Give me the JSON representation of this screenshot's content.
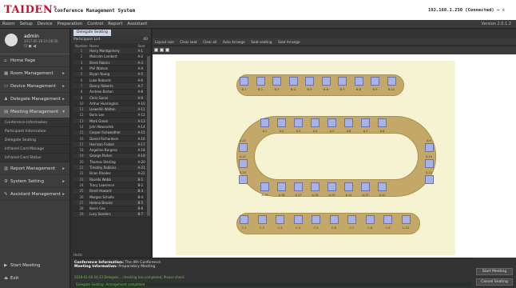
{
  "titlebar": {
    "logo": "TAIDEN",
    "logo_mark": "®",
    "title": "Conference Management System",
    "connection": "192.168.1.230 (Connected)",
    "window_controls": "– ✕"
  },
  "menu": {
    "items": [
      "Room",
      "Setup",
      "Device",
      "Preparation",
      "Control",
      "Report",
      "Assistant"
    ],
    "version": "Version 2.0.1.2"
  },
  "user": {
    "name": "admin",
    "date": "2017-05-18 10:28:26",
    "icons": "⏻ ◼ ◀"
  },
  "nav": {
    "items": [
      {
        "label": "Home Page",
        "icon": "home-icon"
      },
      {
        "label": "Room Management",
        "icon": "room-icon"
      },
      {
        "label": "Device Management",
        "icon": "device-icon"
      },
      {
        "label": "Delegate Management",
        "icon": "delegate-icon"
      },
      {
        "label": "Meeting Management",
        "icon": "meeting-icon"
      }
    ],
    "subitems": [
      "Conference Information",
      "Participant Information",
      "Delegate Seating",
      "Infrared Card Manage",
      "Infrared Card Status"
    ],
    "items2": [
      {
        "label": "Report Management",
        "icon": "report-icon"
      },
      {
        "label": "System Setting",
        "icon": "settings-icon"
      },
      {
        "label": "Assistant Management",
        "icon": "assistant-icon"
      }
    ],
    "bottom": [
      "Start Meeting",
      "Exit"
    ]
  },
  "participants": {
    "tab": "Delegate Seating",
    "header": "Participant List",
    "count": "40",
    "columns": [
      "Number",
      "Name",
      "Seat"
    ],
    "rows": [
      [
        "1",
        "Harry Montgomery",
        "A-1"
      ],
      [
        "2",
        "Malcolm Lambert",
        "A-2"
      ],
      [
        "3",
        "Brent Robins",
        "A-3"
      ],
      [
        "4",
        "Phil Watson",
        "A-4"
      ],
      [
        "5",
        "Bryan Young",
        "A-5"
      ],
      [
        "6",
        "Luke Robards",
        "A-6"
      ],
      [
        "7",
        "Danny Roberts",
        "A-7"
      ],
      [
        "8",
        "Andrew Barton",
        "A-8"
      ],
      [
        "9",
        "Chris Gorse",
        "A-9"
      ],
      [
        "10",
        "Arthur Huntington",
        "A-10"
      ],
      [
        "11",
        "Llewellin Walton",
        "A-11"
      ],
      [
        "12",
        "Boris Lee",
        "A-12"
      ],
      [
        "13",
        "Mark Green",
        "A-13"
      ],
      [
        "14",
        "John Newcomb",
        "A-14"
      ],
      [
        "15",
        "Casper Fairweather",
        "A-15"
      ],
      [
        "16",
        "Daniel Richardson",
        "A-16"
      ],
      [
        "17",
        "Harrison Fosker",
        "A-17"
      ],
      [
        "18",
        "Angeline Burgess",
        "A-18"
      ],
      [
        "19",
        "George Parker",
        "A-19"
      ],
      [
        "20",
        "Thomas Sterling",
        "A-20"
      ],
      [
        "21",
        "Timothy Robbins",
        "A-21"
      ],
      [
        "22",
        "Brian Rhodes",
        "A-22"
      ],
      [
        "23",
        "Rosella Webb",
        "B-1"
      ],
      [
        "24",
        "Tracy Lawrence",
        "B-2"
      ],
      [
        "25",
        "Brent Howard",
        "B-3"
      ],
      [
        "26",
        "Morgan Schults",
        "B-4"
      ],
      [
        "27",
        "Helena Brooks",
        "B-5"
      ],
      [
        "28",
        "Kevin Cox",
        "B-6"
      ],
      [
        "29",
        "Lucy Sanders",
        "B-7"
      ]
    ],
    "footer": "Hosts"
  },
  "toolbar": {
    "buttons": [
      "Layout size",
      "Clear seat",
      "Clear all",
      "Auto Arrange",
      "Seat seating",
      "Seat Arrange"
    ]
  },
  "layout": {
    "rowB": [
      "B-1",
      "B-2",
      "B-3",
      "B-4",
      "B-5",
      "B-6",
      "B-7",
      "B-8",
      "B-9",
      "B-10"
    ],
    "rowC": [
      "C-1",
      "C-2",
      "C-3",
      "C-4",
      "C-5",
      "C-6",
      "C-7",
      "C-8",
      "C-9",
      "C-10"
    ],
    "ovalTop": [
      "A-1",
      "A-2",
      "A-3",
      "A-4",
      "A-5",
      "A-6",
      "A-7",
      "A-8"
    ],
    "ovalBottom": [
      "A-19",
      "A-18",
      "A-17",
      "A-16",
      "A-15",
      "A-14",
      "A-13",
      "A-12"
    ],
    "ovalLeft": [
      "A-22",
      "A-21",
      "A-20"
    ],
    "ovalRight": [
      "A-9",
      "A-10",
      "A-11"
    ]
  },
  "info": {
    "conf_label": "Conference Information:",
    "conf_value": "The 4th Conference",
    "meeting_label": "Meeting Information:",
    "meeting_value": "Preparatory Meeting",
    "log1": "2018-01-06 04:23 Delegate... checking has completed, Please check",
    "log2": "Delegate Seating: Arrangement completed"
  },
  "actions": {
    "start": "Start Meeting",
    "cancel": "Cancel Seating"
  }
}
